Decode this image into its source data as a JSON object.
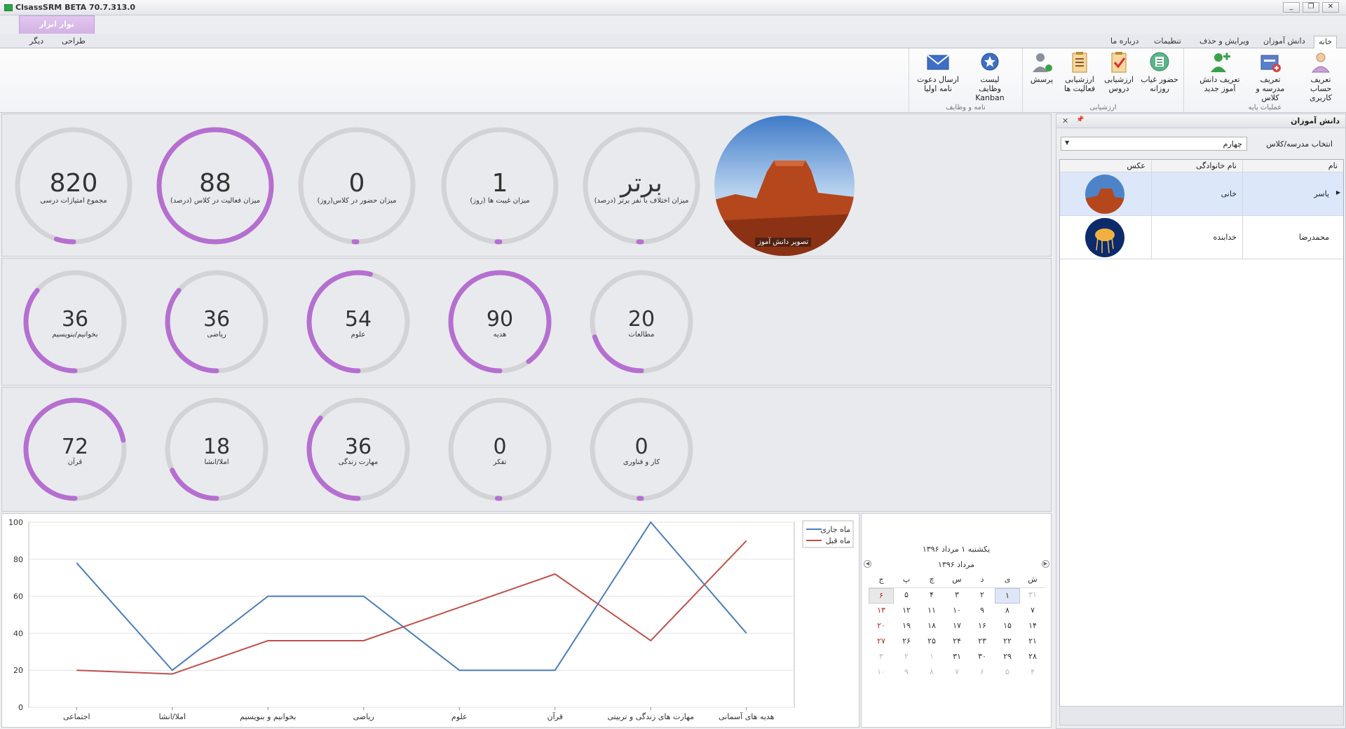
{
  "window": {
    "title": "ClsassSRM BETA 70.7.313.0",
    "controls": [
      "_",
      "❐",
      "✕"
    ]
  },
  "ribbon": {
    "context_tab": "نوار ابزار",
    "context_tabs": [
      "طراحی",
      "دیگر"
    ],
    "tabs": [
      "خانه",
      "دانش آموزان",
      "ویرایش و حذف",
      "تنظیمات",
      "درباره ما"
    ],
    "groups": [
      {
        "label": "عملیات پایه",
        "buttons": [
          {
            "label": "تعریف حساب کاربری",
            "icon": "user-account-icon"
          },
          {
            "label": "تعریف مدرسه و کلاس",
            "icon": "school-class-icon"
          },
          {
            "label": "تعریف دانش آموز جدید",
            "icon": "add-student-icon"
          }
        ]
      },
      {
        "label": "ارزشیابی",
        "buttons": [
          {
            "label": "حضور غیاب روزانه",
            "icon": "attendance-icon"
          },
          {
            "label": "ارزشیابی دروس",
            "icon": "lesson-evaluation-icon"
          },
          {
            "label": "ارزشیابی فعالیت ها",
            "icon": "activity-evaluation-icon"
          },
          {
            "label": "پرسش",
            "icon": "question-icon"
          }
        ]
      },
      {
        "label": "نامه و وظایف",
        "buttons": [
          {
            "label": "لیست وظایف Kanban",
            "icon": "kanban-icon"
          },
          {
            "label": "ارسال دعوت نامه اولیا",
            "icon": "mail-icon"
          }
        ]
      }
    ]
  },
  "student_photo_caption": "تصویر دانش آموز",
  "row1": [
    {
      "value": "برتر",
      "caption": "میزان اختلاف با نفر برتر (درصد)",
      "fill": 0.0
    },
    {
      "value": "1",
      "caption": "میزان غیبت ها (روز)",
      "fill": 0.0
    },
    {
      "value": "0",
      "caption": "میزان حضور در کلاس(روز)",
      "fill": 0.0
    },
    {
      "value": "88",
      "caption": "میزان فعالیت در کلاس (درصد)",
      "fill": 1.0
    },
    {
      "value": "820",
      "caption": "مجموع امتیازات درسی",
      "fill": 0.05
    }
  ],
  "row2": [
    {
      "value": "20",
      "caption": "مطالعات",
      "fill": 0.2
    },
    {
      "value": "90",
      "caption": "هدیه",
      "fill": 0.9
    },
    {
      "value": "54",
      "caption": "علوم",
      "fill": 0.54
    },
    {
      "value": "36",
      "caption": "ریاضی",
      "fill": 0.36
    },
    {
      "value": "36",
      "caption": "بخوانیم/بنویسیم",
      "fill": 0.36
    }
  ],
  "row3": [
    {
      "value": "0",
      "caption": "کار و فناوری",
      "fill": 0.0
    },
    {
      "value": "0",
      "caption": "تفکر",
      "fill": 0.0
    },
    {
      "value": "36",
      "caption": "مهارت زندگی",
      "fill": 0.36
    },
    {
      "value": "18",
      "caption": "املا/انشا",
      "fill": 0.18
    },
    {
      "value": "72",
      "caption": "قرآن",
      "fill": 0.72
    }
  ],
  "chart_data": {
    "type": "line",
    "categories": [
      "اجتماعی",
      "املا/انشا",
      "بخوانیم و بنویسیم",
      "ریاضی",
      "علوم",
      "قرآن",
      "مهارت های زندگی و تربیتی",
      "هدیه های آسمانی"
    ],
    "series": [
      {
        "name": "ماه جاری",
        "color": "#4a7ebb",
        "values": [
          78,
          20,
          60,
          60,
          20,
          20,
          100,
          40
        ]
      },
      {
        "name": "ماه قبل",
        "color": "#c0504d",
        "values": [
          20,
          18,
          36,
          36,
          54,
          72,
          36,
          90
        ]
      }
    ],
    "y_ticks": [
      "0",
      "20",
      "40",
      "60",
      "80",
      "100"
    ],
    "ylim": [
      0,
      100
    ],
    "legend_position": "top-right",
    "grid": true
  },
  "calendar": {
    "title": "یکشنبه ۱ مرداد ۱۳۹۶",
    "month": "مرداد ۱۳۹۶",
    "weekdays": [
      "ش",
      "ی",
      "د",
      "س",
      "چ",
      "پ",
      "ج"
    ],
    "weeks": [
      [
        "۳۱",
        "۱",
        "۲",
        "۳",
        "۴",
        "۵",
        "۶"
      ],
      [
        "۷",
        "۸",
        "۹",
        "۱۰",
        "۱۱",
        "۱۲",
        "۱۳"
      ],
      [
        "۱۴",
        "۱۵",
        "۱۶",
        "۱۷",
        "۱۸",
        "۱۹",
        "۲۰"
      ],
      [
        "۲۱",
        "۲۲",
        "۲۳",
        "۲۴",
        "۲۵",
        "۲۶",
        "۲۷"
      ],
      [
        "۲۸",
        "۲۹",
        "۳۰",
        "۳۱",
        "۱",
        "۲",
        "۳"
      ],
      [
        "۴",
        "۵",
        "۶",
        "۷",
        "۸",
        "۹",
        "۱۰"
      ]
    ]
  },
  "side": {
    "title": "دانش آموزان",
    "pin": "📌",
    "close": "✕",
    "select_label": "انتخاب مدرسه/کلاس",
    "select_value": "چهارم",
    "columns": [
      "نام",
      "نام خانوادگی",
      "عکس"
    ],
    "rows": [
      {
        "first": "یاسر",
        "last": "خانی"
      },
      {
        "first": "محمدرضا",
        "last": "خدابنده"
      }
    ]
  }
}
